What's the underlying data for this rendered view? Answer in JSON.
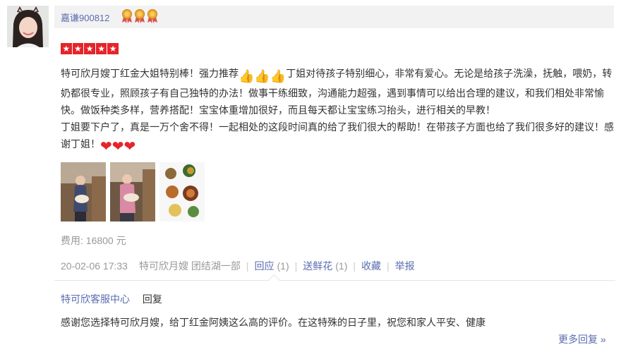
{
  "user": {
    "name": "嘉谦900812",
    "medals": [
      "medal-icon",
      "medal-icon",
      "medal-icon"
    ]
  },
  "rating": {
    "stars": 5,
    "star_color": "#e4242a"
  },
  "review": {
    "p1_a": "特可欣月嫂丁红金大姐特别棒！强力推荐",
    "p1_b": "丁姐对待孩子特别细心，非常有爱心。无论是给孩子洗澡，抚触，喂奶，转奶都很专业，照顾孩子有自己独特的办法！做事干练细致，沟通能力超强，遇到事情可以给出合理的建议，和我们相处非常愉快。做饭种类多样，营养搭配！宝宝体重增加很好，而且每天都让宝宝练习抬头，进行相关的早教！",
    "p2": "丁姐要下户了，真是一万个舍不得！一起相处的这段时间真的给了我们很大的帮助！在带孩子方面也给了我们很多好的建议！感谢丁姐！",
    "thumbs": [
      "👍",
      "👍",
      "👍"
    ],
    "hearts": [
      "❤",
      "❤",
      "❤"
    ]
  },
  "fee": "费用: 16800 元",
  "meta": {
    "date": "20-02-06 17:33",
    "source": "特可欣月嫂 团结湖一部",
    "reply_label": "回应",
    "reply_count": "(1)",
    "flower_label": "送鲜花",
    "flower_count": "(1)",
    "favorite_label": "收藏",
    "report_label": "举报"
  },
  "reply": {
    "author": "特可欣客服中心",
    "label": "回复",
    "text": "感谢您选择特可欣月嫂，给丁红金阿姨这么高的评价。在这特殊的日子里，祝您和家人平安、健康"
  },
  "more_replies": "更多回复 »",
  "colors": {
    "link": "#5a6cb0",
    "muted": "#999999",
    "accent": "#e4242a"
  }
}
